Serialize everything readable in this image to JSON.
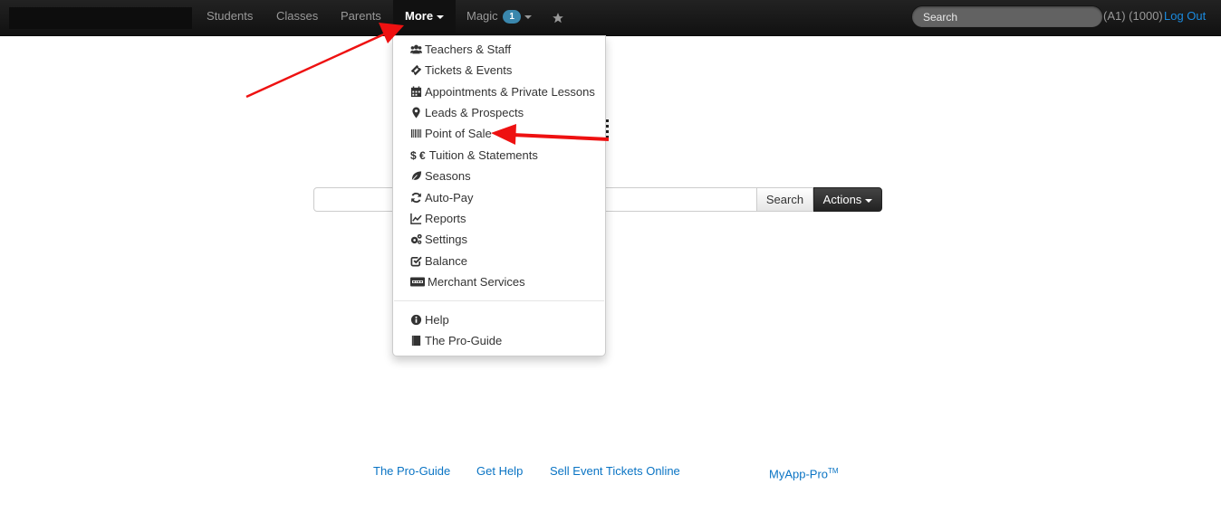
{
  "navbar": {
    "items": [
      {
        "label": "Students"
      },
      {
        "label": "Classes"
      },
      {
        "label": "Parents"
      },
      {
        "label": "More"
      },
      {
        "label": "Magic",
        "badge": "1"
      }
    ],
    "search_placeholder": "Search",
    "user_info": "(A1) (1000)",
    "logout_label": "Log Out"
  },
  "more_menu": {
    "items": [
      {
        "label": "Teachers & Staff",
        "icon": "group-icon"
      },
      {
        "label": "Tickets & Events",
        "icon": "ticket-icon"
      },
      {
        "label": "Appointments & Private Lessons",
        "icon": "calendar-icon"
      },
      {
        "label": "Leads & Prospects",
        "icon": "map-marker-icon"
      },
      {
        "label": "Point of Sale",
        "icon": "barcode-icon"
      },
      {
        "label": "Tuition & Statements",
        "icon": "money-icon",
        "icon_text": "$ €"
      },
      {
        "label": "Seasons",
        "icon": "leaf-icon"
      },
      {
        "label": "Auto-Pay",
        "icon": "refresh-icon"
      },
      {
        "label": "Reports",
        "icon": "line-chart-icon"
      },
      {
        "label": "Settings",
        "icon": "cogs-icon"
      },
      {
        "label": "Balance",
        "icon": "check-square-icon"
      },
      {
        "label": "Merchant Services",
        "icon": "visa-card-icon"
      }
    ],
    "secondary_items": [
      {
        "label": "Help",
        "icon": "info-circle-icon"
      },
      {
        "label": "The Pro-Guide",
        "icon": "book-icon"
      }
    ]
  },
  "main": {
    "search_button_label": "Search",
    "actions_button_label": "Actions"
  },
  "footer": {
    "links": [
      {
        "label": "The Pro-Guide"
      },
      {
        "label": "Get Help"
      },
      {
        "label": "Sell Event Tickets Online"
      }
    ],
    "brand": "MyApp-Pro",
    "brand_mark": "TM"
  },
  "colors": {
    "navbar_bg": "#1b1b1b",
    "link_blue": "#0a74c4",
    "badge_blue": "#3a87ad",
    "annotation_red": "#ee1111"
  }
}
